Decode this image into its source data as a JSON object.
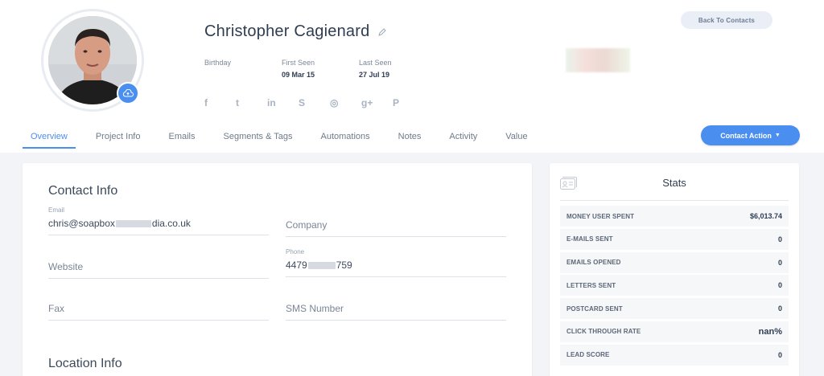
{
  "profile": {
    "name": "Christopher Cagienard",
    "birthday_label": "Birthday",
    "first_seen_label": "First Seen",
    "first_seen_value": "09 Mar 15",
    "last_seen_label": "Last Seen",
    "last_seen_value": "27 Jul 19"
  },
  "socials": [
    {
      "icon": "facebook-icon",
      "glyph": "f"
    },
    {
      "icon": "twitter-icon",
      "glyph": "t"
    },
    {
      "icon": "linkedin-icon",
      "glyph": "in"
    },
    {
      "icon": "skype-icon",
      "glyph": "S"
    },
    {
      "icon": "instagram-icon",
      "glyph": "◎"
    },
    {
      "icon": "google-plus-icon",
      "glyph": "g+"
    },
    {
      "icon": "pinterest-icon",
      "glyph": "P"
    }
  ],
  "header": {
    "back_label": "Back To Contacts",
    "contact_action_label": "Contact Action"
  },
  "tabs": [
    {
      "label": "Overview",
      "active": true
    },
    {
      "label": "Project Info"
    },
    {
      "label": "Emails"
    },
    {
      "label": "Segments & Tags"
    },
    {
      "label": "Automations"
    },
    {
      "label": "Notes"
    },
    {
      "label": "Activity"
    },
    {
      "label": "Value"
    }
  ],
  "contact_info": {
    "title": "Contact Info",
    "email_label": "Email",
    "email_prefix": "chris@soapbox",
    "email_suffix": "dia.co.uk",
    "company_placeholder": "Company",
    "website_placeholder": "Website",
    "phone_label": "Phone",
    "phone_prefix": "4479",
    "phone_suffix": "759",
    "fax_placeholder": "Fax",
    "sms_placeholder": "SMS Number"
  },
  "location_info": {
    "title": "Location Info"
  },
  "stats": {
    "title": "Stats",
    "rows": [
      {
        "label": "MONEY USER SPENT",
        "value": "$6,013.74"
      },
      {
        "label": "E-MAILS SENT",
        "value": "0"
      },
      {
        "label": "EMAILS OPENED",
        "value": "0"
      },
      {
        "label": "LETTERS SENT",
        "value": "0"
      },
      {
        "label": "POSTCARD SENT",
        "value": "0"
      },
      {
        "label": "CLICK THROUGH RATE",
        "value": "nan%"
      },
      {
        "label": "LEAD SCORE",
        "value": "0"
      }
    ]
  },
  "colors": {
    "accent": "#4a8ef0",
    "text": "#3d4a5c",
    "background": "#f3f4f7"
  }
}
